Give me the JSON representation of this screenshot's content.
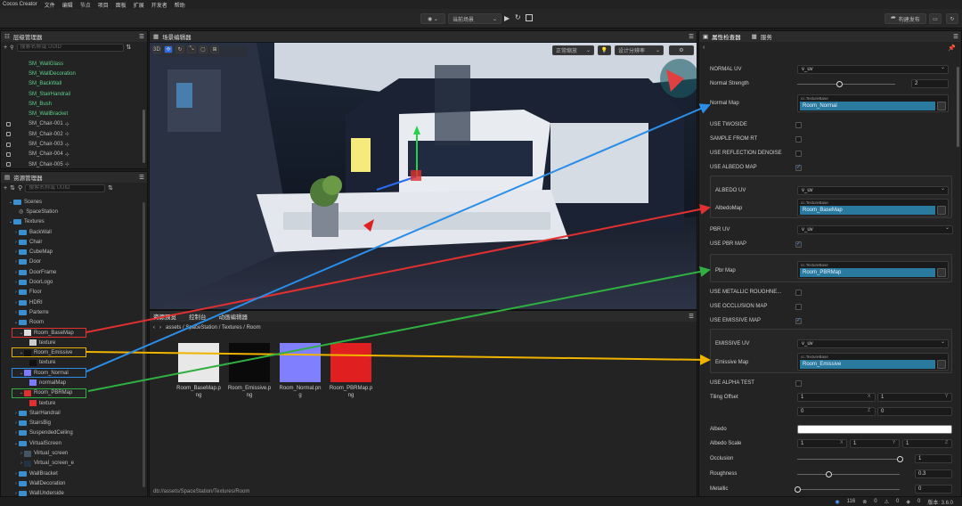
{
  "app": {
    "title": "Cocos Creator",
    "menu": [
      "文件",
      "编辑",
      "节点",
      "项目",
      "面板",
      "扩展",
      "开发者",
      "帮助"
    ]
  },
  "toolbar": {
    "scene_dropdown": "当前场景",
    "build_label": "构建发布",
    "icons": [
      "globe-icon",
      "play-icon",
      "refresh-icon",
      "stop-icon",
      "folder-icon",
      "sync-icon"
    ]
  },
  "hierarchy": {
    "title": "层级管理器",
    "search_placeholder": "搜索名称或 UUID",
    "items": [
      {
        "label": "SM_WallGlass",
        "color": "#5fd08a"
      },
      {
        "label": "SM_WallDecoration",
        "color": "#5fd08a"
      },
      {
        "label": "SM_BackWall",
        "color": "#5fd08a"
      },
      {
        "label": "SM_StairHandrail",
        "color": "#5fd08a"
      },
      {
        "label": "SM_Bush",
        "color": "#5fd08a"
      },
      {
        "label": "SM_WallBracket",
        "color": "#5fd08a"
      },
      {
        "label": "SM_Chair-001",
        "locked": true
      },
      {
        "label": "SM_Chair-002",
        "locked": true
      },
      {
        "label": "SM_Chair-003",
        "locked": true
      },
      {
        "label": "SM_Chair-004",
        "locked": true
      },
      {
        "label": "SM_Chair-005",
        "locked": true
      }
    ]
  },
  "assets_tree": {
    "title": "资源管理器",
    "search_placeholder": "搜索名称或 UUID",
    "items": [
      {
        "label": "Scenes",
        "depth": 1,
        "open": true,
        "type": "folder"
      },
      {
        "label": "SpaceStation",
        "depth": 2,
        "type": "scene"
      },
      {
        "label": "Textures",
        "depth": 1,
        "open": true,
        "type": "folder"
      },
      {
        "label": "BackWall",
        "depth": 2,
        "type": "folder"
      },
      {
        "label": "Chair",
        "depth": 2,
        "type": "folder"
      },
      {
        "label": "CubeMap",
        "depth": 2,
        "type": "folder"
      },
      {
        "label": "Door",
        "depth": 2,
        "type": "folder"
      },
      {
        "label": "DoorFrame",
        "depth": 2,
        "type": "folder"
      },
      {
        "label": "DoorLogo",
        "depth": 2,
        "type": "folder"
      },
      {
        "label": "Floor",
        "depth": 2,
        "type": "folder"
      },
      {
        "label": "HDRI",
        "depth": 2,
        "type": "folder"
      },
      {
        "label": "Parterre",
        "depth": 2,
        "type": "folder"
      },
      {
        "label": "Room",
        "depth": 2,
        "open": true,
        "type": "folder"
      },
      {
        "label": "Room_BaseMap",
        "depth": 3,
        "open": true,
        "type": "image",
        "thumb": "#dddddd",
        "box": "#e03030"
      },
      {
        "label": "texture",
        "depth": 4,
        "type": "tex",
        "thumb": "#cccccc"
      },
      {
        "label": "Room_Emissive",
        "depth": 3,
        "open": true,
        "type": "image",
        "thumb": "#111111",
        "box": "#e8b000"
      },
      {
        "label": "texture",
        "depth": 4,
        "type": "tex",
        "thumb": "#111111"
      },
      {
        "label": "Room_Normal",
        "depth": 3,
        "open": true,
        "type": "image",
        "thumb": "#7b7bff",
        "box": "#2a8ee8"
      },
      {
        "label": "normalMap",
        "depth": 4,
        "type": "tex",
        "thumb": "#7b7bff"
      },
      {
        "label": "Room_PBRMap",
        "depth": 3,
        "open": true,
        "type": "image",
        "thumb": "#e03030",
        "box": "#30b040"
      },
      {
        "label": "texture",
        "depth": 4,
        "type": "tex",
        "thumb": "#e03030"
      },
      {
        "label": "StairHandrail",
        "depth": 2,
        "type": "folder"
      },
      {
        "label": "StairsBig",
        "depth": 2,
        "type": "folder"
      },
      {
        "label": "SuspendedCeiling",
        "depth": 2,
        "type": "folder"
      },
      {
        "label": "VirtualScreen",
        "depth": 2,
        "open": true,
        "type": "folder"
      },
      {
        "label": "Virtual_screen",
        "depth": 3,
        "type": "image",
        "thumb": "#445566"
      },
      {
        "label": "Virtual_screen_e",
        "depth": 3,
        "type": "image",
        "thumb": "#223344"
      },
      {
        "label": "WallBracket",
        "depth": 2,
        "type": "folder"
      },
      {
        "label": "WallDecoration",
        "depth": 2,
        "type": "folder"
      },
      {
        "label": "WallUnderside",
        "depth": 2,
        "type": "folder"
      }
    ]
  },
  "scene_editor": {
    "title": "场景编辑器",
    "zoom_label": "正常缩放",
    "resolution_label": "设计分辨率"
  },
  "asset_preview": {
    "tabs": [
      "资源预览",
      "控制台",
      "动画编辑器"
    ],
    "breadcrumb": "assets / SpaceStation / Textures / Room",
    "files": [
      {
        "name": "Room_BaseMap.png",
        "color": "#e8e8e8"
      },
      {
        "name": "Room_Emissive.png",
        "color": "#0a0a0a"
      },
      {
        "name": "Room_Normal.png",
        "color": "#8080ff"
      },
      {
        "name": "Room_PBRMap.png",
        "color": "#e02020"
      }
    ],
    "footer_path": "db://assets/SpaceStation/Textures/Room"
  },
  "inspector": {
    "tabs": [
      "属性检查器",
      "服务"
    ],
    "normal_uv_label": "NORMAL UV",
    "normal_uv_value": "v_uv",
    "normal_strength_label": "Normal Strength",
    "normal_strength_value": "2",
    "normal_map_label": "Normal Map",
    "texture_type": "cc.TextureBase",
    "normal_map_value": "Room_Normal",
    "use_twoside": "USE TWOSIDE",
    "sample_from_rt": "SAMPLE FROM RT",
    "use_reflection_denoise": "USE REFLECTION DENOISE",
    "use_albedo_map": "USE ALBEDO MAP",
    "albedo_uv_label": "ALBEDO UV",
    "albedo_uv_value": "v_uv",
    "albedo_map_label": "AlbedoMap",
    "albedo_map_value": "Room_BaseMap",
    "pbr_uv_label": "PBR UV",
    "pbr_uv_value": "v_uv",
    "use_pbr_map": "USE PBR MAP",
    "pbr_map_label": "Pbr Map",
    "pbr_map_value": "Room_PBRMap",
    "use_metallic_roughness": "USE METALLIC ROUGHNE...",
    "use_occlusion_map": "USE OCCLUSION MAP",
    "use_emissive_map": "USE EMISSIVE MAP",
    "emissive_uv_label": "EMISSIVE UV",
    "emissive_uv_value": "v_uv",
    "emissive_map_label": "Emissive Map",
    "emissive_map_value": "Room_Emissive",
    "use_alpha_test": "USE ALPHA TEST",
    "tiling_offset_label": "Tiling Offset",
    "tiling": [
      "1",
      "1",
      "0",
      "0"
    ],
    "axis_x": "X",
    "axis_y": "Y",
    "axis_z": "Z",
    "albedo_label": "Albedo",
    "albedo_color": "#ffffff",
    "albedo_scale_label": "Albedo Scale",
    "albedo_scale": [
      "1",
      "1",
      "1"
    ],
    "occlusion_label": "Occlusion",
    "occlusion_value": "1",
    "roughness_label": "Roughness",
    "roughness_value": "0.3",
    "metallic_label": "Metallic",
    "metallic_value": "0",
    "checks": {
      "use_albedo_map": true,
      "use_pbr_map": true,
      "use_emissive_map": true
    }
  },
  "statusbar": {
    "count1": "116",
    "count2": "0",
    "count3": "0",
    "count4": "0",
    "version": "版本: 3.6.0"
  },
  "annotation_colors": {
    "basemap": "#e03030",
    "emissive": "#f0b400",
    "normal": "#2a8ee8",
    "pbr": "#30b040"
  }
}
